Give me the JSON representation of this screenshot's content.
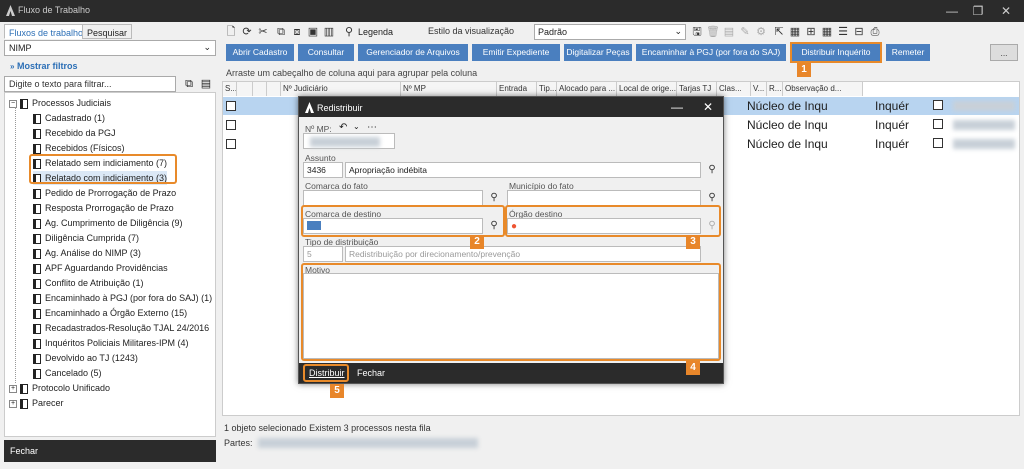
{
  "window": {
    "title": "Fluxo de Trabalho",
    "minimize": "—",
    "restore": "❐",
    "close": "✕"
  },
  "left": {
    "tabs": [
      "Fluxos de trabalho",
      "Pesquisar"
    ],
    "selected_flow": "NIMP",
    "filters_link": "Mostrar filtros",
    "filter_placeholder": "Digite o texto para filtrar...",
    "tree": [
      {
        "label": "Processos Judiciais",
        "level": 0,
        "expanded": true
      },
      {
        "label": "Cadastrado (1)",
        "level": 1
      },
      {
        "label": "Recebido da PGJ",
        "level": 1
      },
      {
        "label": "Recebidos (Físicos)",
        "level": 1
      },
      {
        "label": "Relatado sem indiciamento (7)",
        "level": 1,
        "highlight": true
      },
      {
        "label": "Relatado com indiciamento (3)",
        "level": 1,
        "highlight": true,
        "selected": true
      },
      {
        "label": "Pedido de Prorrogação de Prazo",
        "level": 1
      },
      {
        "label": "Resposta Prorrogação de Prazo",
        "level": 1
      },
      {
        "label": "Ag. Cumprimento de Diligência (9)",
        "level": 1
      },
      {
        "label": "Diligência Cumprida (7)",
        "level": 1
      },
      {
        "label": "Ag. Análise do NIMP (3)",
        "level": 1
      },
      {
        "label": "APF Aguardando Providências",
        "level": 1
      },
      {
        "label": "Conflito de Atribuição (1)",
        "level": 1
      },
      {
        "label": "Encaminhado à PGJ (por fora do SAJ) (1)",
        "level": 1
      },
      {
        "label": "Encaminhado a Órgão Externo (15)",
        "level": 1
      },
      {
        "label": "Recadastrados-Resolução TJAL 24/2016",
        "level": 1
      },
      {
        "label": "Inquéritos Policiais Militares-IPM (4)",
        "level": 1
      },
      {
        "label": "Devolvido ao TJ (1243)",
        "level": 1
      },
      {
        "label": "Cancelado (5)",
        "level": 1
      },
      {
        "label": "Protocolo Unificado",
        "level": 0,
        "expanded": false
      },
      {
        "label": "Parecer",
        "level": 0,
        "expanded": false
      }
    ],
    "close_button": "Fechar"
  },
  "toolbar": {
    "legend": "Legenda",
    "style_label": "Estilo da visualização",
    "style_value": "Padrão"
  },
  "actions": [
    "Abrir Cadastro",
    "Consultar",
    "Gerenciador de Arquivos",
    "Emitir Expediente",
    "Digitalizar Peças",
    "Encaminhar à PGJ (por fora do SAJ)",
    "Distribuir Inquérito",
    "Remeter"
  ],
  "actions_more": "...",
  "grid": {
    "group_hint": "Arraste um cabeçalho de coluna aqui para agrupar pela coluna",
    "columns": [
      "S...",
      "",
      "",
      "",
      "Nº Judiciário",
      "Nº MP",
      "Entrada",
      "Tip...",
      "Alocado para ...",
      "Local de orige...",
      "Tarjas TJ",
      "Clas...",
      "V...",
      "R...",
      "Observação d..."
    ],
    "rows": [
      {
        "local": "Núcleo de Inqu",
        "classe": "Inquér",
        "selected": true
      },
      {
        "local": "Núcleo de Inqu",
        "classe": "Inquér"
      },
      {
        "local": "Núcleo de Inqu",
        "classe": "Inquér"
      }
    ],
    "status": "1 objeto selecionado   Existem 3 processos nesta fila",
    "partes_label": "Partes:"
  },
  "dialog": {
    "title": "Redistribuir",
    "mp_label": "Nº MP:",
    "assunto_label": "Assunto",
    "assunto_code": "3436",
    "assunto_text": "Apropriação indébita",
    "comarca_fato_label": "Comarca do fato",
    "municipio_fato_label": "Município do fato",
    "comarca_destino_label": "Comarca de destino",
    "orgao_destino_label": "Órgão destino",
    "tipo_label": "Tipo de distribuição",
    "tipo_code": "5",
    "tipo_text": "Redistribuição por direcionamento/prevenção",
    "motivo_label": "Motivo",
    "distribuir": "Distribuir",
    "fechar": "Fechar"
  },
  "markers": [
    "1",
    "2",
    "3",
    "4",
    "5"
  ],
  "colors": {
    "accent": "#4a7fbf",
    "highlight": "#e88a2a",
    "titlebar": "#2b2b2b",
    "selected_row": "#b8d4f0"
  }
}
